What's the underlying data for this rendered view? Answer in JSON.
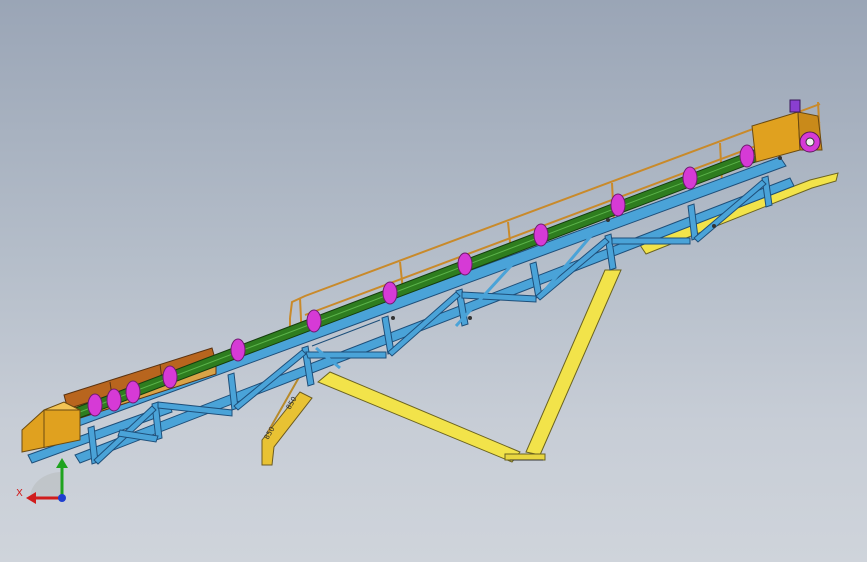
{
  "viewport": {
    "background_top": "#9aa5b6",
    "background_bottom": "#cfd4db"
  },
  "model": {
    "name": "conveyor-3d-model",
    "component_colors": {
      "truss": "#4aa3d8",
      "belt": "#2e7d1f",
      "idlers": "#d63ad6",
      "supports": "#f2e34a",
      "handrail": "#c98a2a",
      "hopper": "#e0a11f",
      "skirt_board": "#b8651e",
      "drive_motor": "#8a3fd0"
    },
    "idler_count": 12
  },
  "triad": {
    "x_label": "X",
    "x_color": "#d01c1c",
    "y_color": "#1fa31f",
    "z_color": "#1f3fd0"
  }
}
